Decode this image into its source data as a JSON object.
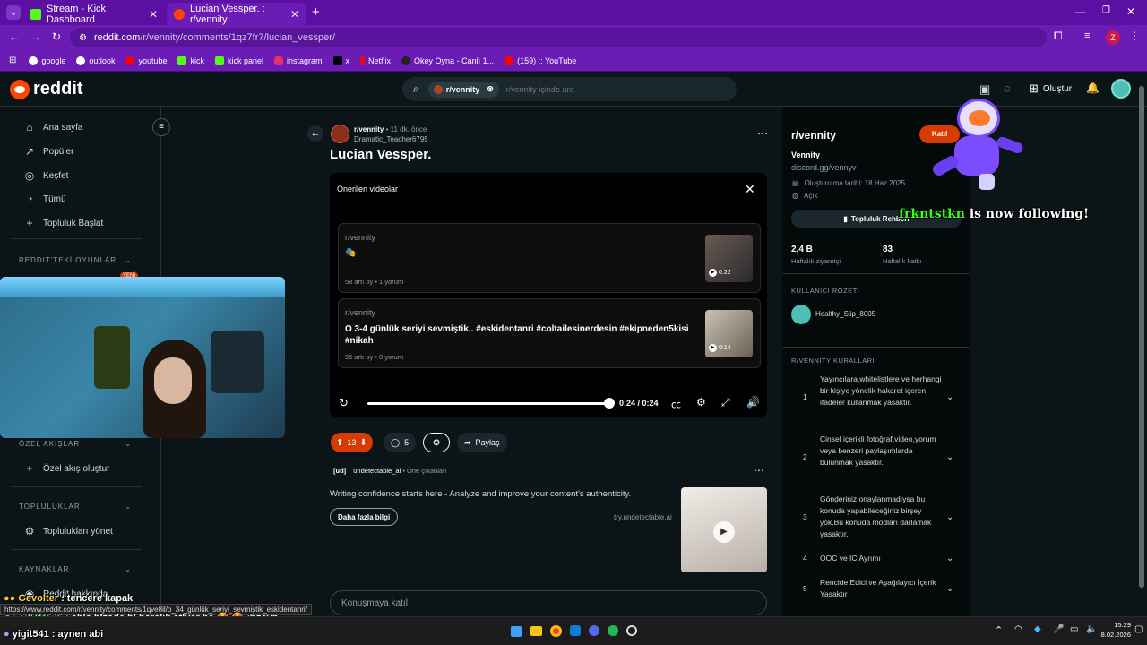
{
  "browser": {
    "tabs": [
      {
        "title": "Stream - Kick Dashboard",
        "active": false
      },
      {
        "title": "Lucian Vessper. : r/vennity",
        "active": true
      }
    ],
    "new_tab": "+",
    "url_host": "reddit.com",
    "url_path": "/r/vennity/comments/1qz7fr7/lucian_vessper/",
    "bookmarks": [
      {
        "label": "google",
        "color": "#ffffff"
      },
      {
        "label": "outlook",
        "color": "#ffffff"
      },
      {
        "label": "youtube",
        "color": "#ff0000"
      },
      {
        "label": "kick",
        "color": "#53fc18"
      },
      {
        "label": "kick panel",
        "color": "#53fc18"
      },
      {
        "label": "instagram",
        "color": "#e1306c"
      },
      {
        "label": "x",
        "color": "#000000"
      },
      {
        "label": "Netflix",
        "color": "#e50914"
      },
      {
        "label": "Okey Oyna - Canlı 1...",
        "color": "#222222"
      },
      {
        "label": "(159) :: YouTube",
        "color": "#ff0000"
      }
    ],
    "profile_letter": "Z"
  },
  "reddit": {
    "logo": "reddit",
    "search_chip": "r/vennity",
    "search_placeholder": "r/vennity içinde ara",
    "create_label": "Oluştur"
  },
  "sidebar": {
    "nav": [
      {
        "label": "Ana sayfa",
        "icon": "home-icon"
      },
      {
        "label": "Popüler",
        "icon": "popular-icon"
      },
      {
        "label": "Keşfet",
        "icon": "explore-icon"
      },
      {
        "label": "Tümü",
        "icon": "all-icon"
      },
      {
        "label": "Topluluk Başlat",
        "icon": "plus-icon"
      }
    ],
    "games_header": "REDDIT'TEKİ OYUNLAR",
    "games_badge": "YENİ",
    "custom_feeds_header": "ÖZEL AKIŞLAR",
    "create_feed": "Özel akış oluştur",
    "communities_header": "TOPLULUKLAR",
    "manage_communities": "Toplulukları yönet",
    "resources_header": "KAYNAKLAR",
    "about_reddit": "Reddit hakkında"
  },
  "post": {
    "subreddit": "r/vennity",
    "time": "11 dk. önce",
    "author": "Dramatic_Teacher6795",
    "title": "Lucian Vessper.",
    "recommended_title": "Önerilen videolar",
    "recommended": [
      {
        "sub": "r/vennity",
        "title": "🎭",
        "stats": "58 artı oy • 1 yorum",
        "duration": "0:22"
      },
      {
        "sub": "r/vennity",
        "title": "O 3-4 günlük seriyi sevmiştik.. #eskidentanri #coltailesinerdesin #ekipneden5kisi #nikah",
        "stats": "95 artı oy • 0 yorum",
        "duration": "0:14"
      }
    ],
    "time_display": "0:24 / 0:24",
    "progress": 1.0,
    "votes": "13",
    "comments": "5",
    "share": "Paylaş",
    "comment_placeholder": "Konuşmaya katıl"
  },
  "ad": {
    "prefix": "[ud]",
    "name": "undetectable_ai",
    "tag": "Öne çıkanlan",
    "text": "Writing confidence starts here - Analyze and improve your content's authenticity.",
    "cta": "Daha fazla bilgi",
    "domain": "try.undetectable.ai"
  },
  "community": {
    "name": "r/vennity",
    "join": "Katıl",
    "title": "Vennity",
    "link": "discord.gg/vennyv",
    "created": "Oluşturulma tarihi: 18 Haz 2025",
    "visibility": "Açık",
    "guide_btn": "Topluluk Rehberi",
    "visitors": "2,4 B",
    "visitors_label": "Haftalık ziyaretçi",
    "contributions": "83",
    "contributions_label": "Haftalık katkı",
    "badge_header": "KULLANICI ROZETİ",
    "badge_user": "Healthy_Slip_8005",
    "rules_header": "R/VENNİTY KURALLARI",
    "rules": [
      {
        "n": "1",
        "text": "Yayıncılara,whitelistlere ve herhangi bir kişiye yönelik hakaret içeren ifadeler kullanmak yasaktır."
      },
      {
        "n": "2",
        "text": "Cinsel içerikli fotoğraf,video,yorum veya benzeri paylaşımlarda bulunmak yasaktır."
      },
      {
        "n": "3",
        "text": "Gönderiniz onaylanmadıysa bu konuda yapabileceğiniz birşey yok.Bu konuda modları darlamak yasaktır."
      },
      {
        "n": "4",
        "text": "OOC ve IC Ayrımı"
      },
      {
        "n": "5",
        "text": "Rencide Edici ve Aşağılayıcı İçerik Yasaktır"
      }
    ]
  },
  "overlay": {
    "follow_user": "frkntstkn",
    "follow_text": "is now following!",
    "chat": [
      {
        "user": "Gevolter",
        "msg": ": tencere kapak"
      },
      {
        "user": "GlHf4535",
        "msg": ": abla bizede bi harçlık ativer he 🤩 🤩 @zeyn"
      },
      {
        "user": "yigit541",
        "msg": ": aynen abi"
      }
    ]
  },
  "status_url": "https://www.reddit.com/r/vennity/comments/1qve8il/o_34_günlük_seriyi_sevmiştik_eskidentanri/",
  "taskbar": {
    "time": "15:29",
    "date": "8.02.2026"
  }
}
